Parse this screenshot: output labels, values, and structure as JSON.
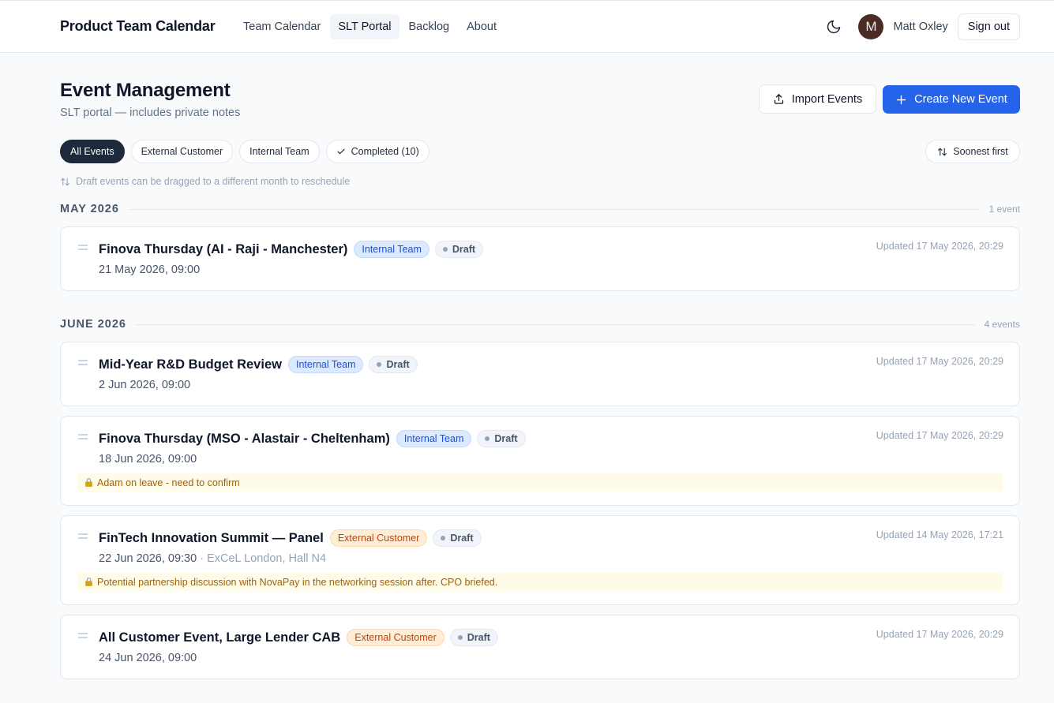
{
  "header": {
    "brand": "Product Team Calendar",
    "nav": [
      {
        "label": "Team Calendar",
        "active": false
      },
      {
        "label": "SLT Portal",
        "active": true
      },
      {
        "label": "Backlog",
        "active": false
      },
      {
        "label": "About",
        "active": false
      }
    ],
    "theme_icon": "moon-icon",
    "avatar_initial": "M",
    "user_name": "Matt Oxley",
    "sign_out": "Sign out"
  },
  "page": {
    "title": "Event Management",
    "subtitle": "SLT portal — includes private notes",
    "import_label": "Import Events",
    "create_label": "Create New Event",
    "accent_color": "#2563eb"
  },
  "filters": {
    "chips": [
      {
        "label": "All Events",
        "active": true
      },
      {
        "label": "External Customer",
        "active": false
      },
      {
        "label": "Internal Team",
        "active": false
      },
      {
        "label": "Completed (10)",
        "active": false,
        "icon": "check-icon"
      }
    ],
    "sort_label": "Soonest first"
  },
  "hint": "Draft events can be dragged to a different month to reschedule",
  "months": [
    {
      "label": "MAY 2026",
      "count": "1 event",
      "events": [
        {
          "title": "Finova Thursday (AI - Raji - Manchester)",
          "category": "Internal Team",
          "status": "Draft",
          "date": "21 May 2026, 09:00",
          "location": "",
          "updated": "Updated 17 May 2026, 20:29",
          "note": ""
        }
      ]
    },
    {
      "label": "JUNE 2026",
      "count": "4 events",
      "events": [
        {
          "title": "Mid-Year R&D Budget Review",
          "category": "Internal Team",
          "status": "Draft",
          "date": "2 Jun 2026, 09:00",
          "location": "",
          "updated": "Updated 17 May 2026, 20:29",
          "note": ""
        },
        {
          "title": "Finova Thursday (MSO - Alastair - Cheltenham)",
          "category": "Internal Team",
          "status": "Draft",
          "date": "18 Jun 2026, 09:00",
          "location": "",
          "updated": "Updated 17 May 2026, 20:29",
          "note": "Adam on leave - need to confirm"
        },
        {
          "title": "FinTech Innovation Summit — Panel",
          "category": "External Customer",
          "status": "Draft",
          "date": "22 Jun 2026, 09:30",
          "location": " · ExCeL London, Hall N4",
          "updated": "Updated 14 May 2026, 17:21",
          "note": "Potential partnership discussion with NovaPay in the networking session after. CPO briefed."
        },
        {
          "title": "All Customer Event, Large Lender CAB",
          "category": "External Customer",
          "status": "Draft",
          "date": "24 Jun 2026, 09:00",
          "location": "",
          "updated": "Updated 17 May 2026, 20:29",
          "note": ""
        }
      ]
    }
  ]
}
